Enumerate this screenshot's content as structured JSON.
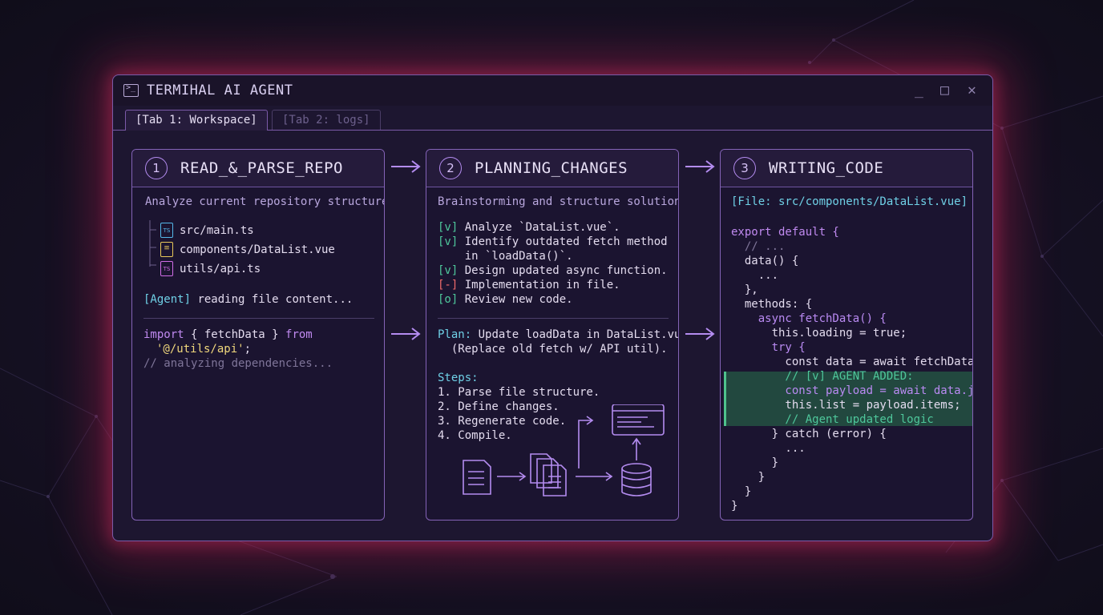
{
  "window": {
    "title": "TERMIHAL AI AGENT",
    "controls": {
      "minimize": "_",
      "maximize": "□",
      "close": "✕"
    }
  },
  "tabs": [
    {
      "label": "[Tab 1: Workspace]",
      "active": true
    },
    {
      "label": "[Tab 2: logs]",
      "active": false
    }
  ],
  "panels": {
    "read": {
      "number": "1",
      "title": "READ_&_PARSE_REPO",
      "subtitle": "Analyze current repository structure.",
      "files": [
        "src/main.ts",
        "components/DataList.vue",
        "utils/api.ts"
      ],
      "file_icon_labels": [
        "TS",
        "",
        "TS"
      ],
      "agent_tag": "[Agent]",
      "agent_status": " reading file content...",
      "code": {
        "import_kw": "import",
        "import_body": " { fetchData } ",
        "from_kw": "from",
        "module_path": "'@/utils/api'",
        "semicolon": ";",
        "comment": "// analyzing dependencies..."
      }
    },
    "plan": {
      "number": "2",
      "title": "PLANNING_CHANGES",
      "subtitle": "Brainstorming and structure solution.",
      "checklist": [
        {
          "mark": "[v]",
          "text": " Analyze `DataList.vue`."
        },
        {
          "mark": "[v]",
          "text": " Identify outdated fetch method"
        },
        {
          "mark": "",
          "text": "    in `loadData()`."
        },
        {
          "mark": "[v]",
          "text": " Design updated async function."
        },
        {
          "mark": "[-]",
          "text": " Implementation in file."
        },
        {
          "mark": "[o]",
          "text": " Review new code."
        }
      ],
      "plan_label": "Plan:",
      "plan_text": " Update loadData in DataList.vue",
      "plan_note": "  (Replace old fetch w/ API util).",
      "steps_label": "Steps:",
      "steps": [
        "1. Parse file structure.",
        "2. Define changes.",
        "3. Regenerate code.",
        "4. Compile."
      ]
    },
    "write": {
      "number": "3",
      "title": "WRITING_CODE",
      "file_header": "[File: src/components/DataList.vue]",
      "code_lines": [
        "export default {",
        "  // ...",
        "  data() {",
        "    ...",
        "  },",
        "  methods: {",
        "    async fetchData() {",
        "      this.loading = true;",
        "      try {",
        "        const data = await fetchData();",
        "        // [v] AGENT ADDED:",
        "        const payload = await data.json();",
        "        this.list = payload.items;",
        "        // Agent updated logic",
        "      } catch (error) {",
        "        ...",
        "      }",
        "    }",
        "  }",
        "}"
      ]
    }
  },
  "colors": {
    "accent": "#b48cf0",
    "keyword": "#c08af0",
    "string": "#f0d77c",
    "comment": "#7f7599",
    "checked": "#4ec79b",
    "in_progress": "#ee6b6b",
    "highlight": "#22483f",
    "glow": "#d2245f"
  }
}
